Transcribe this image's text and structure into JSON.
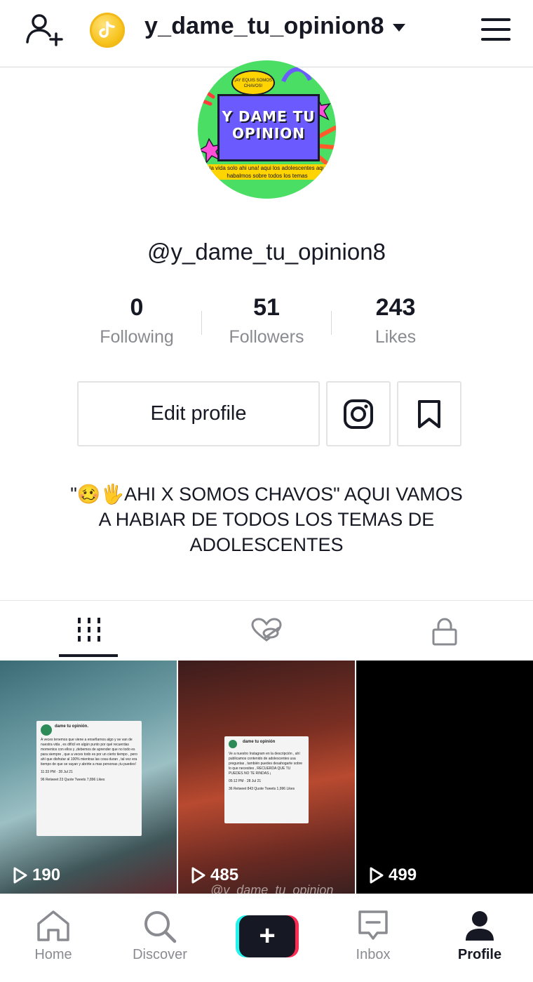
{
  "header": {
    "username": "y_dame_tu_opinion8"
  },
  "avatar": {
    "bubble_text": "¡AY EQUIS SOMOS CHAVOS!",
    "title": "Y DAME TU OPINION",
    "subtitle": "¡la vida solo ahi una! aqui los adolescentes aqui habalmos sobre todos los temas"
  },
  "profile": {
    "handle": "@y_dame_tu_opinion8",
    "stats": [
      {
        "value": "0",
        "label": "Following"
      },
      {
        "value": "51",
        "label": "Followers"
      },
      {
        "value": "243",
        "label": "Likes"
      }
    ],
    "edit_label": "Edit profile",
    "bio": "\"🥴🖐AHI X SOMOS CHAVOS\" AQUI VAMOS A HABIAR DE TODOS LOS TEMAS DE ADOLESCENTES"
  },
  "videos": [
    {
      "views": "190",
      "card_name": "dame tu opinión.",
      "card_text": "A veces tenemos que viene a enseñarnos algo y se van de nuestra vida , es difícil en algún punto por qué recuerdas momentos con ellos y ,debemos de aprender que no todo es para siempre , que a veces todo es por un cierto tiempo , pero ahí que disfrutar al 100% mientras las cosa duran , tal vez era tiempo de que se vayan y abrirte a mas personas ¡tu puedes!",
      "card_meta": "11:33 PM · 28 Jul 21",
      "card_stats": "96 Retweet  23 Quote Tweets  7,896 Likes"
    },
    {
      "views": "485",
      "card_name": "dame tu opinión",
      "card_text": "Ve a nuestro Instagram en la descripción , ahí publicamos contenido de adolescentes usa preguntas , también puedes desahogarte sobre lo que necesites , RECUERDA QUE TU PUEDES NO TE RINDAS ¡",
      "card_meta": "05:12 PM · 28 Jul 21",
      "card_stats": "36 Retweet  843 Quote Tweets  1,996 Likes",
      "watermark": "@y_dame_tu_opinion"
    },
    {
      "views": "499"
    }
  ],
  "nav": [
    {
      "label": "Home",
      "icon": "home-icon"
    },
    {
      "label": "Discover",
      "icon": "search-icon"
    },
    {
      "label": "",
      "icon": "plus-icon"
    },
    {
      "label": "Inbox",
      "icon": "inbox-icon"
    },
    {
      "label": "Profile",
      "icon": "profile-icon"
    }
  ],
  "colors": {
    "text": "#161823",
    "secondary": "#8a8b91",
    "accent_cyan": "#25f4ee",
    "accent_red": "#fe2c55"
  }
}
